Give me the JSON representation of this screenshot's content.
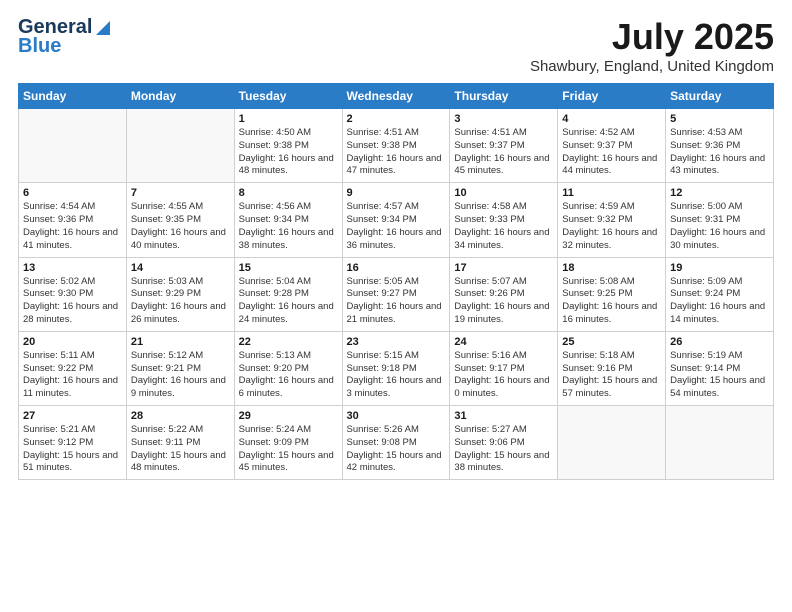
{
  "logo": {
    "line1": "General",
    "line2": "Blue"
  },
  "title": "July 2025",
  "subtitle": "Shawbury, England, United Kingdom",
  "days_of_week": [
    "Sunday",
    "Monday",
    "Tuesday",
    "Wednesday",
    "Thursday",
    "Friday",
    "Saturday"
  ],
  "weeks": [
    [
      {
        "day": "",
        "info": ""
      },
      {
        "day": "",
        "info": ""
      },
      {
        "day": "1",
        "info": "Sunrise: 4:50 AM\nSunset: 9:38 PM\nDaylight: 16 hours and 48 minutes."
      },
      {
        "day": "2",
        "info": "Sunrise: 4:51 AM\nSunset: 9:38 PM\nDaylight: 16 hours and 47 minutes."
      },
      {
        "day": "3",
        "info": "Sunrise: 4:51 AM\nSunset: 9:37 PM\nDaylight: 16 hours and 45 minutes."
      },
      {
        "day": "4",
        "info": "Sunrise: 4:52 AM\nSunset: 9:37 PM\nDaylight: 16 hours and 44 minutes."
      },
      {
        "day": "5",
        "info": "Sunrise: 4:53 AM\nSunset: 9:36 PM\nDaylight: 16 hours and 43 minutes."
      }
    ],
    [
      {
        "day": "6",
        "info": "Sunrise: 4:54 AM\nSunset: 9:36 PM\nDaylight: 16 hours and 41 minutes."
      },
      {
        "day": "7",
        "info": "Sunrise: 4:55 AM\nSunset: 9:35 PM\nDaylight: 16 hours and 40 minutes."
      },
      {
        "day": "8",
        "info": "Sunrise: 4:56 AM\nSunset: 9:34 PM\nDaylight: 16 hours and 38 minutes."
      },
      {
        "day": "9",
        "info": "Sunrise: 4:57 AM\nSunset: 9:34 PM\nDaylight: 16 hours and 36 minutes."
      },
      {
        "day": "10",
        "info": "Sunrise: 4:58 AM\nSunset: 9:33 PM\nDaylight: 16 hours and 34 minutes."
      },
      {
        "day": "11",
        "info": "Sunrise: 4:59 AM\nSunset: 9:32 PM\nDaylight: 16 hours and 32 minutes."
      },
      {
        "day": "12",
        "info": "Sunrise: 5:00 AM\nSunset: 9:31 PM\nDaylight: 16 hours and 30 minutes."
      }
    ],
    [
      {
        "day": "13",
        "info": "Sunrise: 5:02 AM\nSunset: 9:30 PM\nDaylight: 16 hours and 28 minutes."
      },
      {
        "day": "14",
        "info": "Sunrise: 5:03 AM\nSunset: 9:29 PM\nDaylight: 16 hours and 26 minutes."
      },
      {
        "day": "15",
        "info": "Sunrise: 5:04 AM\nSunset: 9:28 PM\nDaylight: 16 hours and 24 minutes."
      },
      {
        "day": "16",
        "info": "Sunrise: 5:05 AM\nSunset: 9:27 PM\nDaylight: 16 hours and 21 minutes."
      },
      {
        "day": "17",
        "info": "Sunrise: 5:07 AM\nSunset: 9:26 PM\nDaylight: 16 hours and 19 minutes."
      },
      {
        "day": "18",
        "info": "Sunrise: 5:08 AM\nSunset: 9:25 PM\nDaylight: 16 hours and 16 minutes."
      },
      {
        "day": "19",
        "info": "Sunrise: 5:09 AM\nSunset: 9:24 PM\nDaylight: 16 hours and 14 minutes."
      }
    ],
    [
      {
        "day": "20",
        "info": "Sunrise: 5:11 AM\nSunset: 9:22 PM\nDaylight: 16 hours and 11 minutes."
      },
      {
        "day": "21",
        "info": "Sunrise: 5:12 AM\nSunset: 9:21 PM\nDaylight: 16 hours and 9 minutes."
      },
      {
        "day": "22",
        "info": "Sunrise: 5:13 AM\nSunset: 9:20 PM\nDaylight: 16 hours and 6 minutes."
      },
      {
        "day": "23",
        "info": "Sunrise: 5:15 AM\nSunset: 9:18 PM\nDaylight: 16 hours and 3 minutes."
      },
      {
        "day": "24",
        "info": "Sunrise: 5:16 AM\nSunset: 9:17 PM\nDaylight: 16 hours and 0 minutes."
      },
      {
        "day": "25",
        "info": "Sunrise: 5:18 AM\nSunset: 9:16 PM\nDaylight: 15 hours and 57 minutes."
      },
      {
        "day": "26",
        "info": "Sunrise: 5:19 AM\nSunset: 9:14 PM\nDaylight: 15 hours and 54 minutes."
      }
    ],
    [
      {
        "day": "27",
        "info": "Sunrise: 5:21 AM\nSunset: 9:12 PM\nDaylight: 15 hours and 51 minutes."
      },
      {
        "day": "28",
        "info": "Sunrise: 5:22 AM\nSunset: 9:11 PM\nDaylight: 15 hours and 48 minutes."
      },
      {
        "day": "29",
        "info": "Sunrise: 5:24 AM\nSunset: 9:09 PM\nDaylight: 15 hours and 45 minutes."
      },
      {
        "day": "30",
        "info": "Sunrise: 5:26 AM\nSunset: 9:08 PM\nDaylight: 15 hours and 42 minutes."
      },
      {
        "day": "31",
        "info": "Sunrise: 5:27 AM\nSunset: 9:06 PM\nDaylight: 15 hours and 38 minutes."
      },
      {
        "day": "",
        "info": ""
      },
      {
        "day": "",
        "info": ""
      }
    ]
  ]
}
